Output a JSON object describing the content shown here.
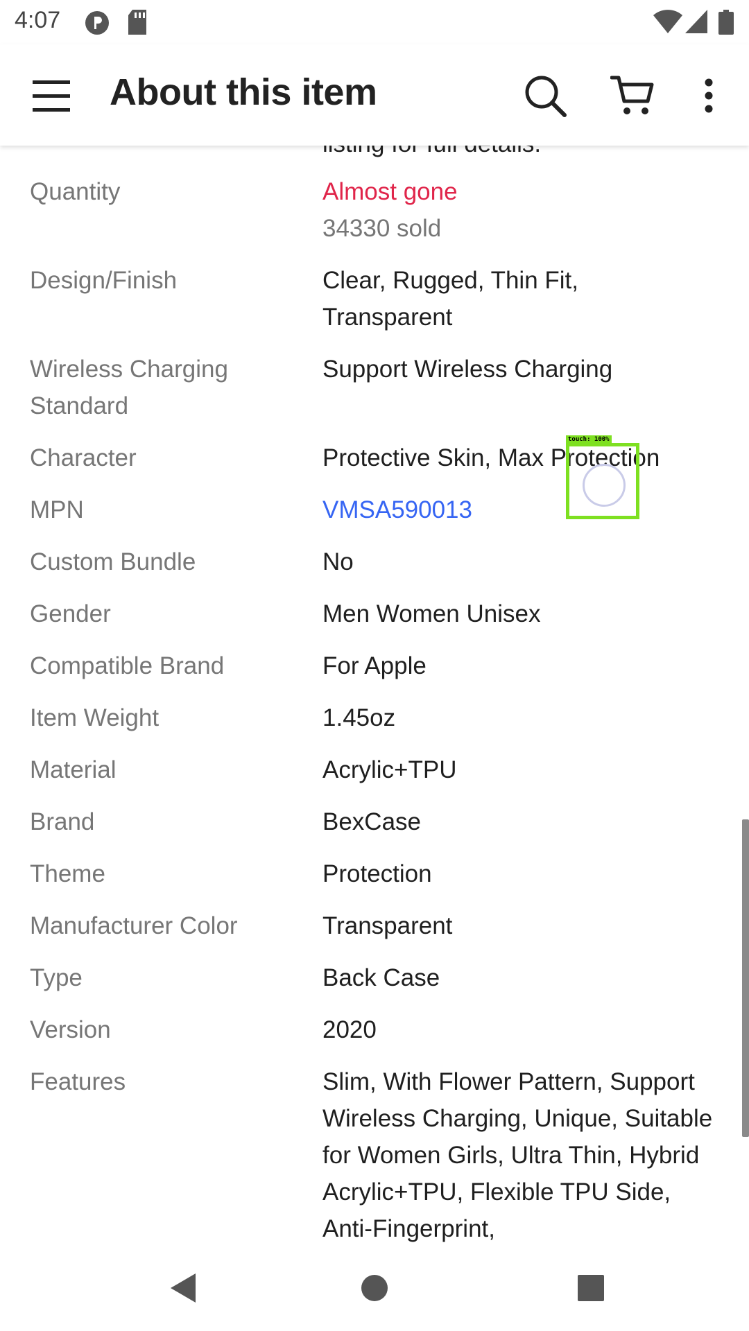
{
  "status_bar": {
    "time": "4:07",
    "icons": [
      "app-notification-icon",
      "sd-card-icon",
      "wifi-icon",
      "signal-icon",
      "battery-icon"
    ]
  },
  "app_bar": {
    "title": "About this item",
    "icons": [
      "menu-icon",
      "search-icon",
      "cart-icon",
      "more-vert-icon"
    ]
  },
  "content": {
    "cut_text": "listing for full details.",
    "specs": [
      {
        "label": "Quantity",
        "value": "Almost gone",
        "value2": "34330 sold"
      },
      {
        "label": "Design/Finish",
        "value": "Clear, Rugged, Thin Fit, Transparent"
      },
      {
        "label": "Wireless Charging Standard",
        "value": "Support Wireless Charging"
      },
      {
        "label": "Character",
        "value": "Protective Skin, Max Protection"
      },
      {
        "label": "MPN",
        "value": "VMSA590013"
      },
      {
        "label": "Custom Bundle",
        "value": "No"
      },
      {
        "label": "Gender",
        "value": "Men Women Unisex"
      },
      {
        "label": "Compatible Brand",
        "value": "For Apple"
      },
      {
        "label": "Item Weight",
        "value": "1.45oz"
      },
      {
        "label": "Material",
        "value": "Acrylic+TPU"
      },
      {
        "label": "Brand",
        "value": "BexCase"
      },
      {
        "label": "Theme",
        "value": "Protection"
      },
      {
        "label": "Manufacturer Color",
        "value": "Transparent"
      },
      {
        "label": "Type",
        "value": "Back Case"
      },
      {
        "label": "Version",
        "value": "2020"
      },
      {
        "label": "Features",
        "value": "Slim, With Flower Pattern, Support Wireless Charging, Unique, Suitable for Women Girls, Ultra Thin, Hybrid Acrylic+TPU, Flexible TPU Side, Anti-Fingerprint,"
      }
    ]
  },
  "touch_overlay": {
    "label": "touch: 100%"
  },
  "colors": {
    "accent_red": "#e0254a",
    "link_blue": "#3665f3",
    "label_gray": "#767676"
  },
  "nav_bar": {
    "icons": [
      "back-icon",
      "home-icon",
      "recents-icon"
    ]
  }
}
